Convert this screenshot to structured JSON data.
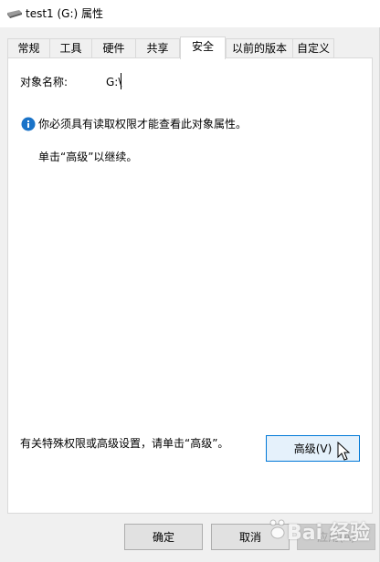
{
  "window": {
    "title": "test1 (G:) 属性"
  },
  "tabs": [
    {
      "label": "常规"
    },
    {
      "label": "工具"
    },
    {
      "label": "硬件"
    },
    {
      "label": "共享"
    },
    {
      "label": "安全"
    },
    {
      "label": "以前的版本"
    },
    {
      "label": "自定义"
    }
  ],
  "active_tab": "安全",
  "security": {
    "object_name_label": "对象名称:",
    "object_name_value": "G:\\",
    "info_message": "你必须具有读取权限才能查看此对象属性。",
    "continue_hint": "单击“高级”以继续。",
    "advanced_hint": "有关特殊权限或高级设置，请单击“高级”。",
    "advanced_button": "高级(V)"
  },
  "footer": {
    "ok_button": "确定",
    "cancel_button": "取消",
    "apply_button": "应用(A)"
  },
  "watermark": {
    "text": "Bai 经验"
  },
  "colors": {
    "info_icon": "#1a73c8",
    "focus_border": "#0078d7",
    "panel_background": "#ffffff",
    "window_background": "#f0f0f0"
  },
  "icons": {
    "title": "drive-icon",
    "info": "info-icon",
    "cursor": "mouse-pointer-icon"
  }
}
